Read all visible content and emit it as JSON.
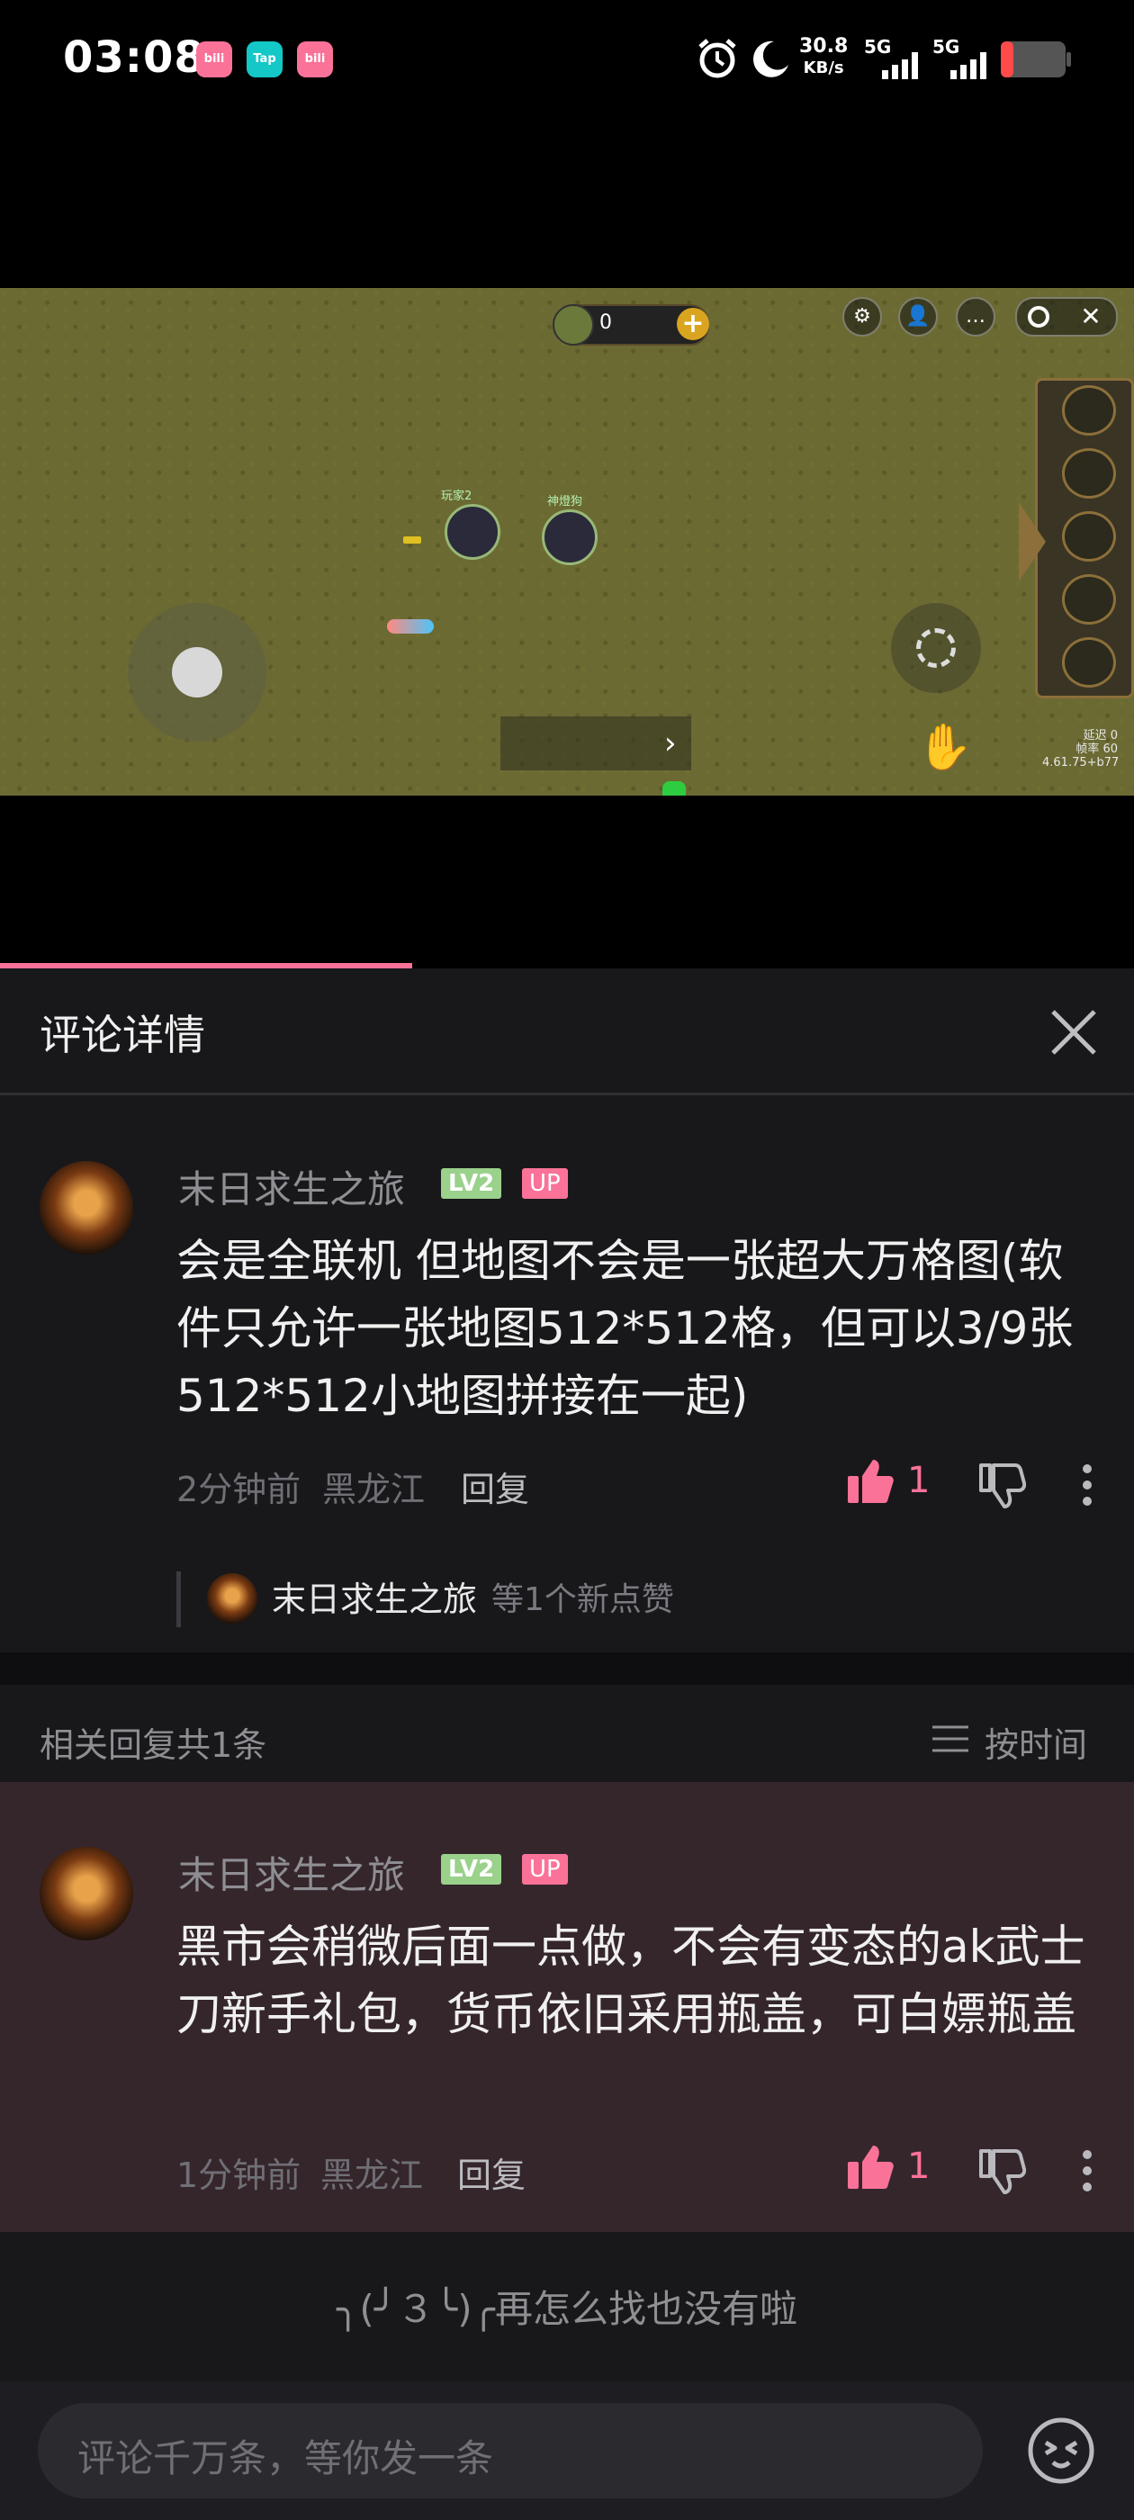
{
  "status_bar": {
    "time": "03:08",
    "apps": [
      {
        "icon": "bilibili-icon",
        "label": "bili"
      },
      {
        "icon": "taptap-icon",
        "label": "Tap"
      },
      {
        "icon": "bilibili-icon",
        "label": "bili"
      }
    ],
    "net_speed": "30.8",
    "net_unit": "KB/s",
    "sim1": "5G",
    "sim2": "5G",
    "icons": [
      "alarm-icon",
      "moon-icon",
      "signal-icon",
      "battery-icon"
    ]
  },
  "game": {
    "coin_count": "0",
    "player_labels": [
      "玩家2",
      "神燈狗"
    ],
    "fps_lines": [
      "延迟 0",
      "帧率 60",
      "4.61.75+b77"
    ],
    "hud_icons": [
      "settings-icon",
      "person-icon",
      "chat-icon",
      "record-icon",
      "close-icon"
    ],
    "side_icons": [
      "bag-icon",
      "book-icon",
      "home-icon",
      "mail-icon",
      "gear-icon"
    ]
  },
  "panel": {
    "title": "评论详情",
    "main_comment": {
      "user": "末日求生之旅",
      "level": "LV2",
      "badge": "UP",
      "content": "会是全联机 但地图不会是一张超大万格图(软件只允许一张地图512*512格，但可以3/9张512*512小地图拼接在一起)",
      "time": "2分钟前",
      "location": "黑龙江",
      "reply_label": "回复",
      "likes": "1"
    },
    "like_notice": {
      "user": "末日求生之旅",
      "text": "等1个新点赞"
    },
    "related": {
      "header": "相关回复共1条",
      "sort_label": "按时间"
    },
    "reply_comment": {
      "user": "末日求生之旅",
      "level": "LV2",
      "badge": "UP",
      "content": "黑市会稍微后面一点做，不会有变态的ak武士刀新手礼包，货币依旧采用瓶盖，可白嫖瓶盖",
      "time": "1分钟前",
      "location": "黑龙江",
      "reply_label": "回复",
      "likes": "1"
    },
    "end_text": "╮(╯３╰)╭再怎么找也没有啦",
    "input_placeholder": "评论千万条，等你发一条"
  },
  "colors": {
    "accent": "#fb7299",
    "panel_bg": "#18181b",
    "highlight_bg": "#35262c",
    "level_badge": "#9ad18b"
  }
}
